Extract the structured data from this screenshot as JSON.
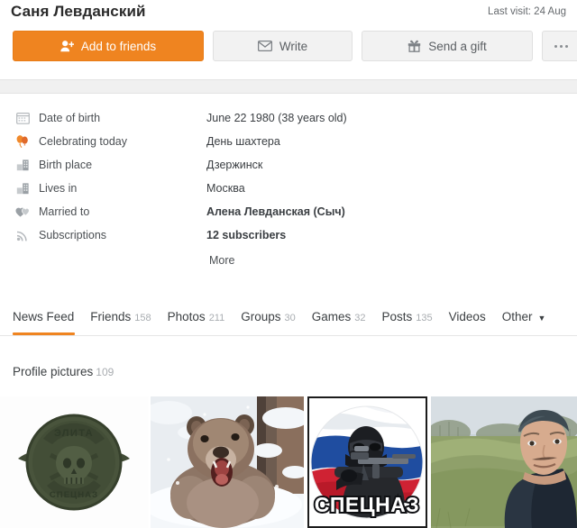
{
  "header": {
    "profile_name": "Саня Левданский",
    "last_visit": "Last visit: 24 Aug"
  },
  "actions": {
    "add_friend": "Add to friends",
    "write": "Write",
    "gift": "Send a gift",
    "more_menu": "…",
    "icons": {
      "add_friend": "person-add-icon",
      "write": "envelope-icon",
      "gift": "gift-icon",
      "more": "ellipsis-icon"
    },
    "accent_color": "#ef8420"
  },
  "info": {
    "rows": [
      {
        "icon": "calendar-icon",
        "label": "Date of birth",
        "value": "June 22 1980 (38 years old)",
        "bold": false
      },
      {
        "icon": "balloons-icon",
        "label": "Celebrating today",
        "value": "День шахтера",
        "bold": false
      },
      {
        "icon": "city-icon",
        "label": "Birth place",
        "value": "Дзержинск",
        "bold": false
      },
      {
        "icon": "city-icon",
        "label": "Lives in",
        "value": "Москва",
        "bold": false
      },
      {
        "icon": "hearts-icon",
        "label": "Married to",
        "value": "Алена Левданская (Сыч)",
        "bold": true
      },
      {
        "icon": "broadcast-icon",
        "label": "Subscriptions",
        "value": "12 subscribers",
        "bold": true
      }
    ],
    "more_label": "More"
  },
  "tabs": {
    "items": [
      {
        "label": "News Feed",
        "count": "",
        "active": true,
        "caret": false
      },
      {
        "label": "Friends",
        "count": "158",
        "active": false,
        "caret": false
      },
      {
        "label": "Photos",
        "count": "211",
        "active": false,
        "caret": false
      },
      {
        "label": "Groups",
        "count": "30",
        "active": false,
        "caret": false
      },
      {
        "label": "Games",
        "count": "32",
        "active": false,
        "caret": false
      },
      {
        "label": "Posts",
        "count": "135",
        "active": false,
        "caret": false
      },
      {
        "label": "Videos",
        "count": "",
        "active": false,
        "caret": false
      },
      {
        "label": "Other",
        "count": "",
        "active": false,
        "caret": true
      }
    ],
    "caret_glyph": "▼"
  },
  "gallery": {
    "title": "Profile pictures",
    "count": "109",
    "photos": [
      {
        "name": "military-patch-photo",
        "alt": "Olive green military skull patch on white background",
        "caption": ""
      },
      {
        "name": "bear-snow-photo",
        "alt": "Brown bear roaring in snow",
        "caption": ""
      },
      {
        "name": "spetsnaz-photo",
        "alt": "Masked soldier with rifle over Russian flag circle",
        "caption": "СПЕЦНАЗ"
      },
      {
        "name": "man-outdoors-photo",
        "alt": "Man in dark jacket standing in a green field",
        "caption": ""
      }
    ]
  }
}
